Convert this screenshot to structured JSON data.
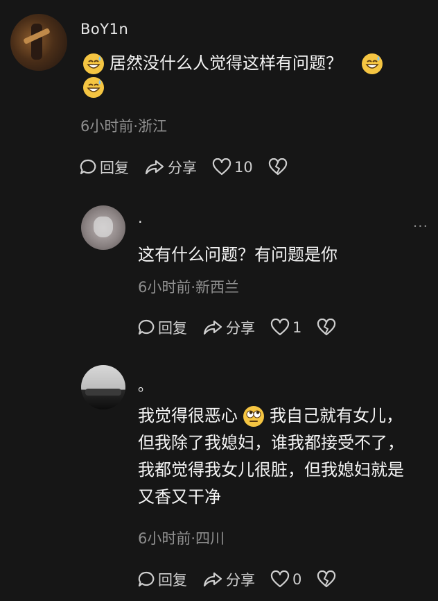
{
  "comments": [
    {
      "username": "BoY1n",
      "text_before": "居然没什么人觉得这样有问题？",
      "emoji": "grinning-sweat-emoji",
      "time_location": "6小时前·浙江",
      "reply_label": "回复",
      "share_label": "分享",
      "like_count": "10"
    },
    {
      "username": "·",
      "text": "这有什么问题？有问题是你",
      "time_location": "6小时前·新西兰",
      "reply_label": "回复",
      "share_label": "分享",
      "like_count": "1",
      "more_label": "···"
    },
    {
      "username": "。",
      "line1_before": "我觉得很恶心",
      "emoji": "eye-roll-emoji",
      "line1_after": "我自己就有女儿，",
      "line2": "但我除了我媳妇，谁我都接受不了，",
      "line3": "我都觉得我女儿很脏，但我媳妇就是",
      "line4": "又香又干净",
      "time_location": "6小时前·四川",
      "reply_label": "回复",
      "share_label": "分享",
      "like_count": "0"
    }
  ],
  "colors": {
    "background": "#161616",
    "meta_text": "#8f8f8f",
    "emoji_yellow": "#f5c542"
  }
}
